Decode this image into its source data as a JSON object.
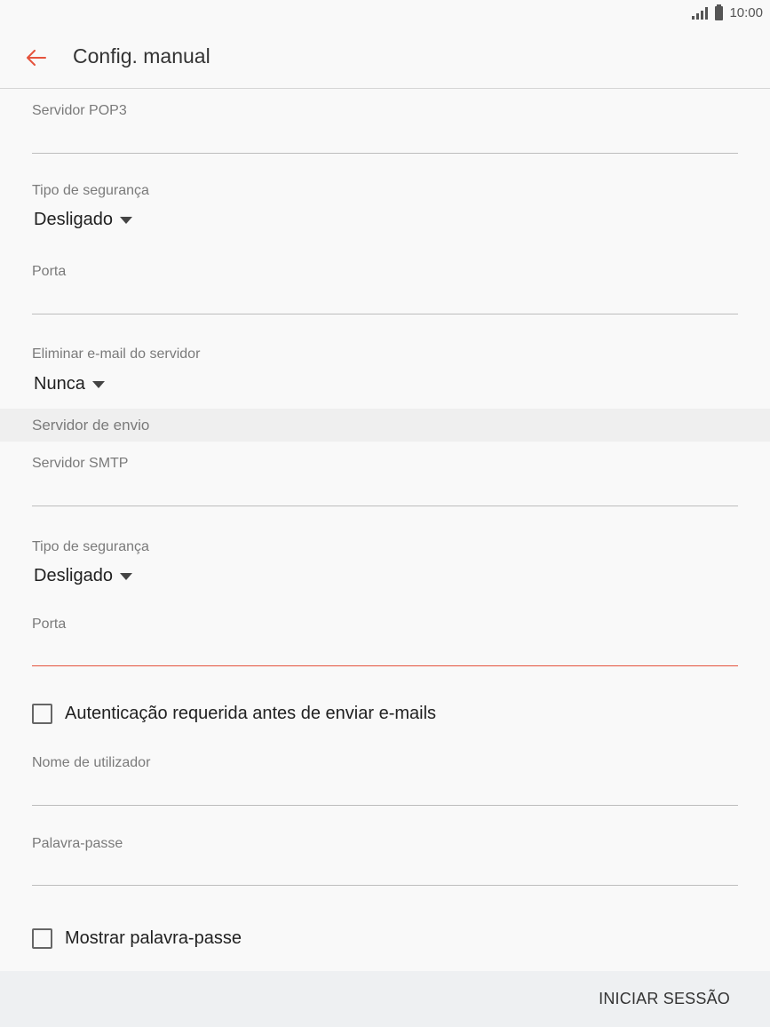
{
  "status_bar": {
    "time": "10:00",
    "signal_icon": "signal-icon",
    "battery_icon": "battery-icon"
  },
  "app_bar": {
    "title": "Config. manual",
    "back_icon": "arrow-back-icon"
  },
  "incoming": {
    "pop3_server_label": "Servidor POP3",
    "pop3_server_value": "",
    "security_label": "Tipo de segurança",
    "security_value": "Desligado",
    "port_label": "Porta",
    "port_value": "",
    "delete_label": "Eliminar e-mail do servidor",
    "delete_value": "Nunca"
  },
  "outgoing": {
    "section_title": "Servidor de envio",
    "smtp_server_label": "Servidor SMTP",
    "smtp_server_value": "",
    "security_label": "Tipo de segurança",
    "security_value": "Desligado",
    "port_label": "Porta",
    "port_value": "",
    "auth_checkbox_label": "Autenticação requerida antes de enviar e-mails",
    "auth_checked": false,
    "username_label": "Nome de utilizador",
    "username_value": "",
    "password_label": "Palavra-passe",
    "password_value": "",
    "show_password_label": "Mostrar palavra-passe",
    "show_password_checked": false
  },
  "footer": {
    "sign_in_label": "INICIAR SESSÃO"
  },
  "colors": {
    "accent": "#e5533d",
    "background": "#f9f9f9",
    "section_bg": "#efefef",
    "footer_bg": "#eef0f2"
  }
}
